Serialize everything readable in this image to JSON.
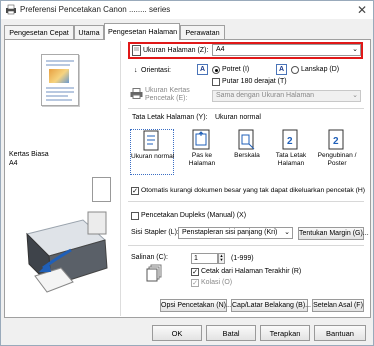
{
  "window": {
    "title": "Preferensi Pencetakan Canon ........ series"
  },
  "tabs": [
    {
      "label": "Pengesetan Cepat"
    },
    {
      "label": "Utama"
    },
    {
      "label": "Pengesetan Halaman"
    },
    {
      "label": "Perawatan"
    }
  ],
  "left_panel": {
    "media_type": "Kertas Biasa",
    "media_size": "A4"
  },
  "page_size": {
    "label": "Ukuran Halaman (Z):",
    "value": "A4"
  },
  "orientation": {
    "label": "Orientasi:",
    "portrait_label": "Potret (I)",
    "landscape_label": "Lanskap (D)",
    "rotate_label": "Putar 180 derajat (T)",
    "selected": "portrait"
  },
  "printer_paper_size": {
    "label_line1": "Ukuran Kertas",
    "label_line2": "Pencetak (E):",
    "value": "Sama dengan Ukuran Halaman"
  },
  "page_layout": {
    "label": "Tata Letak Halaman (Y):",
    "value": "Ukuran normal",
    "options": [
      {
        "label": "Ukuran normal"
      },
      {
        "label_line1": "Pas ke",
        "label_line2": "Halaman"
      },
      {
        "label": "Berskala"
      },
      {
        "label_line1": "Tata Letak",
        "label_line2": "Halaman"
      },
      {
        "label_line1": "Pengubinan /",
        "label_line2": "Poster"
      }
    ],
    "layout_number": "2"
  },
  "auto_reduce_label": "Otomatis kurangi dokumen besar yang tak dapat dikeluarkan pencetak (H)",
  "duplex_label": "Pencetakan Dupleks (Manual) (X)",
  "stapling": {
    "label": "Sisi Stapler (L):",
    "value": "Penstapleran sisi panjang (Kri)",
    "margin_button": "Tentukan Margin (G)..."
  },
  "copies": {
    "label": "Salinan (C):",
    "value": "1",
    "range": "(1-999)",
    "last_page_first_label": "Cetak dari Halaman Terakhir (R)",
    "collate_label": "Kolasi (O)"
  },
  "buttons": {
    "print_options": "Opsi Pencetakan (N)...",
    "stamp_background": "Cap/Latar Belakang (B)...",
    "defaults": "Setelan Asal (F)",
    "ok": "OK",
    "cancel": "Batal",
    "apply": "Terapkan",
    "help": "Bantuan"
  },
  "icons": {
    "app": "printer-icon",
    "close": "close-icon",
    "portrait": "portrait-A-icon",
    "landscape": "landscape-A-icon",
    "paper_size": "printer-paper-icon",
    "layout": "layout-icon",
    "copies": "copies-stack-icon"
  },
  "colors": {
    "highlight_border": "#e01818",
    "selection": "#3b6fc4"
  }
}
